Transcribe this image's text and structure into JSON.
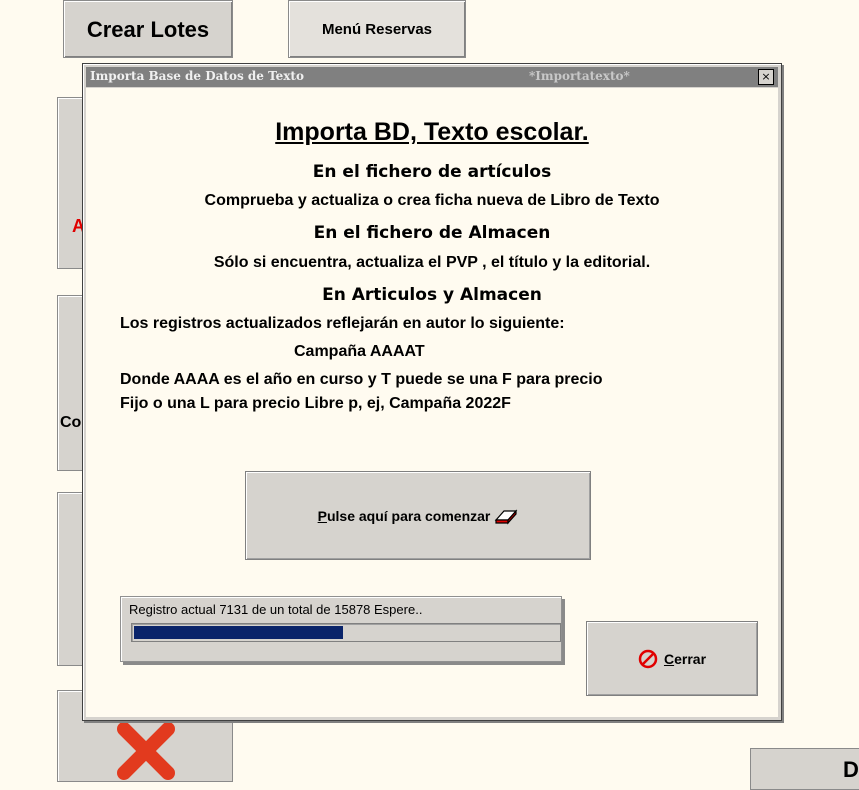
{
  "background_tabs": {
    "lotes_label": "Crear Lotes",
    "reservas_label": "Menú Reservas",
    "side_a_letter": "A",
    "side_b_letters": "Co"
  },
  "dialog": {
    "title": "Importa Base de Datos de Texto",
    "title_form": "*Importatexto*",
    "close_glyph": "×",
    "heading": "Importa BD, Texto escolar.",
    "section1_title": "En el fichero de artículos",
    "section1_text": "Comprueba y actualiza o crea ficha nueva de Libro de Texto",
    "section2_title": "En el fichero de Almacen",
    "section2_text": "Sólo si encuentra, actualiza el PVP , el título y la editorial.",
    "section3_title": "En Articulos y Almacen",
    "section3_text1": "Los registros actualizados reflejarán en  autor  lo siguiente:",
    "section3_text2": "Campaña AAAAT",
    "section3_text3": "Donde AAAA es el año en curso y T puede se una F para precio",
    "section3_text4": "Fijo o una L para precio Libre p, ej, Campaña 2022F",
    "start_button_mnemonic": "P",
    "start_button_rest": "ulse aquí para comenzar",
    "start_icon": "eraser-icon",
    "status_text": "Registro actual 7131 de un total de 15878 Espere..",
    "progress_fraction": 0.493,
    "close_button_mnemonic": "C",
    "close_button_rest": "errar",
    "close_icon": "cancel-icon"
  },
  "colors": {
    "progress": "#0A246A",
    "cancel_red": "#E00000",
    "background": "#FFFBF0"
  }
}
